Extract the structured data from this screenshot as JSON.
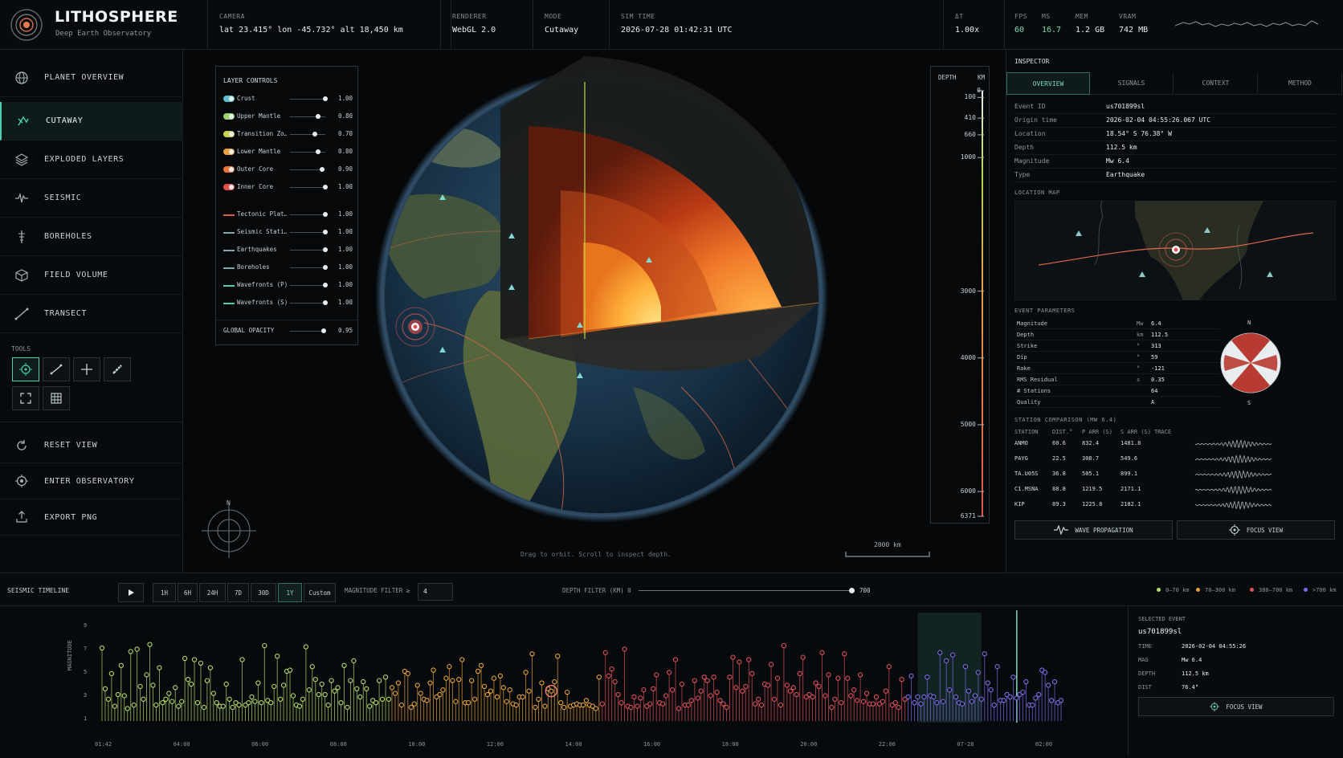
{
  "app": {
    "title": "LITHOSPHERE",
    "subtitle": "Deep Earth Observatory"
  },
  "topbar": {
    "camera_label": "CAMERA",
    "camera_value": "lat 23.415° lon -45.732° alt 18,450 km",
    "renderer_label": "RENDERER",
    "renderer_value": "WebGL 2.0",
    "mode_label": "MODE",
    "mode_value": "Cutaway",
    "simtime_label": "SIM TIME",
    "simtime_value": "2026-07-28 01:42:31 UTC",
    "dt_label": "ΔT",
    "dt_value": "1.00x",
    "fps_label": "FPS",
    "fps_value": "60",
    "ms_label": "MS",
    "ms_value": "16.7",
    "mem_label": "MEM",
    "mem_value": "1.2 GB",
    "vram_label": "VRAM",
    "vram_value": "742 MB"
  },
  "sidebar": {
    "items": [
      {
        "label": "PLANET OVERVIEW",
        "icon": "globe-icon"
      },
      {
        "label": "CUTAWAY",
        "icon": "cutaway-icon",
        "active": true
      },
      {
        "label": "EXPLODED LAYERS",
        "icon": "layers-icon"
      },
      {
        "label": "SEISMIC",
        "icon": "waveform-icon"
      },
      {
        "label": "BOREHOLES",
        "icon": "borehole-icon"
      },
      {
        "label": "FIELD VOLUME",
        "icon": "cube-icon"
      },
      {
        "label": "TRANSECT",
        "icon": "transect-icon"
      }
    ],
    "tools_label": "TOOLS",
    "tools": [
      "target-icon",
      "line-icon",
      "crosshair-icon",
      "ruler-icon",
      "fullscreen-icon",
      "grid-icon"
    ],
    "actions": [
      {
        "label": "RESET VIEW",
        "icon": "reset-icon"
      },
      {
        "label": "ENTER OBSERVATORY",
        "icon": "observatory-icon"
      },
      {
        "label": "EXPORT PNG",
        "icon": "export-icon"
      }
    ]
  },
  "layers": {
    "title": "LAYER CONTROLS",
    "items": [
      {
        "name": "Crust",
        "value": "1.00",
        "color": "#5bc0c9",
        "kind": "toggle",
        "level": 1.0
      },
      {
        "name": "Upper Mantle",
        "value": "0.80",
        "color": "#9ad26b",
        "kind": "toggle",
        "level": 0.8
      },
      {
        "name": "Transition Zo…",
        "value": "0.70",
        "color": "#c6d14b",
        "kind": "toggle",
        "level": 0.7
      },
      {
        "name": "Lower Mantle",
        "value": "0.80",
        "color": "#e9a23b",
        "kind": "toggle",
        "level": 0.8
      },
      {
        "name": "Outer Core",
        "value": "0.90",
        "color": "#e8743a",
        "kind": "toggle",
        "level": 0.9
      },
      {
        "name": "Inner Core",
        "value": "1.00",
        "color": "#e0504a",
        "kind": "toggle",
        "level": 1.0
      },
      {
        "name": "Tectonic Plat…",
        "value": "1.00",
        "color": "#e05a4c",
        "kind": "line",
        "level": 1.0
      },
      {
        "name": "Seismic Stati…",
        "value": "1.00",
        "color": "#7fa8b0",
        "kind": "line",
        "level": 1.0
      },
      {
        "name": "Earthquakes",
        "value": "1.00",
        "color": "#7fa8b0",
        "kind": "line",
        "level": 1.0
      },
      {
        "name": "Boreholes",
        "value": "1.00",
        "color": "#7fa8b0",
        "kind": "line",
        "level": 1.0
      },
      {
        "name": "Wavefronts (P)",
        "value": "1.00",
        "color": "#4ad0b0",
        "kind": "line",
        "level": 1.0
      },
      {
        "name": "Wavefronts (S)",
        "value": "1.00",
        "color": "#4ad0b0",
        "kind": "line",
        "level": 1.0
      }
    ],
    "global_label": "GLOBAL OPACITY",
    "global_value": "0.95",
    "global_level": 0.95
  },
  "viewport": {
    "hint": "Drag to orbit. Scroll to inspect depth.",
    "scale_label": "2000 km",
    "compass_label": "N"
  },
  "depthscale": {
    "depth_label": "DEPTH",
    "unit_label": "KM",
    "ticks": [
      "0",
      "100",
      "410",
      "660",
      "1000",
      "3000",
      "4000",
      "5000",
      "6000",
      "6371"
    ]
  },
  "inspector": {
    "title": "INSPECTOR",
    "tabs": [
      "OVERVIEW",
      "SIGNALS",
      "CONTEXT",
      "METHOD"
    ],
    "fields": [
      {
        "k": "Event ID",
        "v": "us701899sl"
      },
      {
        "k": "Origin time",
        "v": "2026-02-04 04:55:26.067 UTC"
      },
      {
        "k": "Location",
        "v": "18.54° S 76.38° W"
      },
      {
        "k": "Depth",
        "v": "112.5 km"
      },
      {
        "k": "Magnitude",
        "v": "Mw 6.4"
      },
      {
        "k": "Type",
        "v": "Earthquake"
      }
    ],
    "location_map_label": "LOCATION MAP",
    "event_params_label": "EVENT PARAMETERS",
    "params": [
      {
        "k": "Magnitude",
        "u": "Mw",
        "v": "6.4"
      },
      {
        "k": "Depth",
        "u": "km",
        "v": "112.5"
      },
      {
        "k": "Strike",
        "u": "°",
        "v": "313"
      },
      {
        "k": "Dip",
        "u": "°",
        "v": "59"
      },
      {
        "k": "Rake",
        "u": "°",
        "v": "-121"
      },
      {
        "k": "RMS Residual",
        "u": "s",
        "v": "0.35"
      },
      {
        "k": "# Stations",
        "u": "",
        "v": "64"
      },
      {
        "k": "Quality",
        "u": "",
        "v": "A"
      }
    ],
    "beachball_n": "N",
    "beachball_s": "S",
    "station_label": "STATION COMPARISON (MW 6.4)",
    "station_headers": [
      "STATION",
      "DIST.°",
      "P ARR (S)",
      "S ARR (S)",
      "TRACE"
    ],
    "stations": [
      [
        "ANMO",
        "60.6",
        "832.4",
        "1481.8"
      ],
      [
        "PAYG",
        "22.5",
        "308.7",
        "549.6"
      ],
      [
        "TA.U05S",
        "36.8",
        "505.1",
        "899.1"
      ],
      [
        "C1.MSNA",
        "88.8",
        "1219.5",
        "2171.1"
      ],
      [
        "KIP",
        "89.3",
        "1225.8",
        "2182.1"
      ]
    ],
    "wave_button": "WAVE PROPAGATION",
    "focus_button": "FOCUS VIEW"
  },
  "timeline_bar": {
    "label": "SEISMIC TIMELINE",
    "ranges": [
      "1H",
      "6H",
      "24H",
      "7D",
      "30D",
      "1Y",
      "Custom"
    ],
    "active_range": "1Y",
    "mag_filter_label": "MAGNITUDE FILTER ≥",
    "mag_filter_value": "4",
    "depth_filter_label": "DEPTH FILTER (KM) 0",
    "depth_filter_max": "700",
    "legend": [
      {
        "label": "0–70 km",
        "color": "#b6d96a"
      },
      {
        "label": "70–300 km",
        "color": "#e8a23c"
      },
      {
        "label": "300–700 km",
        "color": "#e0505a"
      },
      {
        "label": ">700 km",
        "color": "#7a6ee8"
      }
    ]
  },
  "chart_data": {
    "type": "scatter",
    "ylabel": "MAGNITUDE",
    "ylim": [
      1,
      9
    ],
    "yticks": [
      "1",
      "3",
      "5",
      "7",
      "9"
    ],
    "xticks": [
      "01:42",
      "04:00",
      "06:00",
      "08:00",
      "10:00",
      "12:00",
      "14:00",
      "16:00",
      "18:00",
      "20:00",
      "22:00",
      "07-28",
      "02:00"
    ],
    "values": [
      7.0,
      3.5,
      2.6,
      4.8,
      2.0,
      3.0,
      5.5,
      2.9,
      1.8,
      6.7,
      2.1,
      6.9,
      3.7,
      2.6,
      4.7,
      7.3,
      3.8,
      2.1,
      5.3,
      2.3,
      2.6,
      3.1,
      2.4,
      3.6,
      2.0,
      2.4,
      6.1,
      4.3,
      3.9,
      6.0,
      2.3,
      5.7,
      1.9,
      4.2,
      5.3,
      3.1,
      2.3,
      2.0,
      2.0,
      3.9,
      2.6,
      1.9,
      2.3,
      2.1,
      6.0,
      2.1,
      2.3,
      2.8,
      2.4,
      4.0,
      2.3,
      7.2,
      2.5,
      2.3,
      3.7,
      6.3,
      2.6,
      3.8,
      5.0,
      5.1,
      2.9,
      2.1,
      2.0,
      2.6,
      7.1,
      3.4,
      5.4,
      4.3,
      3.0,
      3.9,
      3.0,
      2.1,
      4.2,
      3.3,
      3.6,
      2.3,
      5.5,
      1.9,
      4.2,
      5.9,
      3.5,
      2.8,
      4.1,
      3.5,
      2.0,
      2.5,
      2.3,
      4.2,
      2.6,
      4.5,
      2.6,
      3.6,
      3.1,
      4.0,
      2.1,
      5.0,
      4.8,
      1.9,
      2.2,
      3.8,
      3.1,
      2.6,
      2.5,
      4.0,
      5.1,
      2.8,
      3.0,
      3.4,
      4.4,
      5.4,
      4.2,
      2.4,
      4.3,
      6.0,
      2.3,
      2.3,
      4.2,
      2.6,
      5.0,
      5.5,
      3.7,
      3.0,
      3.3,
      4.4,
      2.8,
      4.6,
      3.6,
      2.4,
      3.4,
      2.2,
      2.1,
      2.8,
      2.8,
      4.9,
      3.3,
      6.5,
      1.9,
      2.6,
      4.0,
      2.0,
      3.5,
      3.3,
      4.1,
      6.3,
      2.3,
      1.9,
      3.2,
      2.0,
      2.1,
      2.2,
      2.1,
      2.1,
      2.5,
      2.1,
      2.0,
      1.8,
      4.5,
      2.2,
      6.6,
      4.6,
      5.2,
      4.1,
      3.0,
      2.3,
      6.9,
      2.0,
      1.9,
      2.8,
      2.0,
      2.7,
      3.4,
      2.0,
      2.2,
      3.5,
      4.7,
      2.3,
      2.2,
      2.9,
      4.9,
      3.4,
      6.0,
      1.8,
      3.9,
      2.1,
      2.1,
      2.5,
      4.2,
      2.7,
      3.3,
      4.5,
      4.2,
      2.9,
      4.5,
      3.2,
      2.5,
      2.2,
      1.9,
      4.5,
      6.2,
      3.6,
      5.8,
      3.3,
      3.7,
      6.0,
      4.8,
      2.2,
      2.6,
      2.1,
      3.9,
      3.8,
      5.6,
      2.6,
      4.4,
      2.1,
      7.2,
      3.8,
      3.3,
      3.6,
      3.0,
      4.8,
      6.2,
      2.8,
      3.0,
      2.8,
      4.0,
      3.7,
      6.6,
      2.9,
      4.7,
      1.9,
      2.6,
      4.4,
      2.3,
      6.5,
      4.4,
      2.9,
      3.4,
      2.5,
      4.7,
      2.4,
      3.1,
      2.2,
      2.2,
      2.8,
      2.2,
      2.4,
      3.3,
      5.4,
      2.1,
      2.3,
      1.9,
      4.3,
      2.6,
      2.8,
      4.6,
      2.3,
      2.8,
      2.2,
      2.8,
      4.5,
      2.9,
      2.8,
      2.3,
      6.6,
      2.4,
      5.9,
      3.4,
      6.4,
      2.8,
      2.3,
      2.2,
      5.4,
      3.3,
      2.4,
      2.9,
      4.9,
      2.6,
      6.5,
      4.0,
      3.4,
      2.1,
      5.4,
      2.5,
      2.5,
      3.0,
      2.8,
      4.5,
      2.7,
      3.0,
      3.2,
      4.1,
      2.1,
      2.1,
      2.7,
      3.0,
      5.1,
      4.9,
      3.8,
      2.5,
      4.1,
      2.3,
      2.5
    ],
    "selected_index": 141,
    "highlight_range": [
      256,
      276
    ]
  },
  "selected_event": {
    "title": "SELECTED EVENT",
    "id": "us701899sl",
    "rows": [
      {
        "k": "TIME",
        "v": "2026-02-04 04:55:26"
      },
      {
        "k": "MAG",
        "v": "Mw 6.4"
      },
      {
        "k": "DEPTH",
        "v": "112.5 km"
      },
      {
        "k": "DIST",
        "v": "76.4°"
      }
    ],
    "focus_button": "FOCUS VIEW"
  }
}
